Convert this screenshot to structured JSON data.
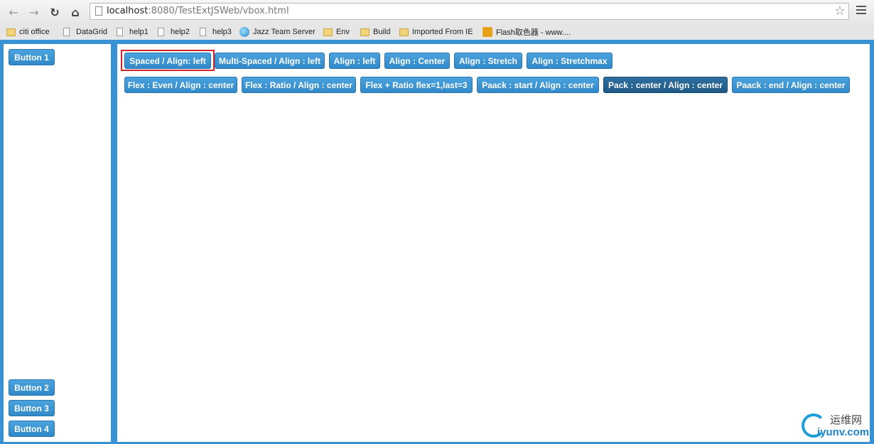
{
  "browser": {
    "url_host": "localhost",
    "url_rest": ":8080/TestExtJSWeb/vbox.html",
    "bookmarks": [
      {
        "label": "citi office",
        "icon": "folder-icon"
      },
      {
        "label": "DataGrid",
        "icon": "page-icon"
      },
      {
        "label": "help1",
        "icon": "page-icon"
      },
      {
        "label": "help2",
        "icon": "page-icon"
      },
      {
        "label": "help3",
        "icon": "page-icon"
      },
      {
        "label": "Jazz Team Server",
        "icon": "globe-icon"
      },
      {
        "label": "Env",
        "icon": "folder-icon"
      },
      {
        "label": "Build",
        "icon": "folder-icon"
      },
      {
        "label": "Imported From IE",
        "icon": "folder-icon"
      },
      {
        "label": "Flash取色器 - www....",
        "icon": "flash-icon"
      }
    ]
  },
  "west_panel": {
    "buttons": [
      "Button 1",
      "Button 2",
      "Button 3",
      "Button 4"
    ]
  },
  "center_panel": {
    "row1": [
      "Spaced / Align: left",
      "Multi-Spaced / Align : left",
      "Align : left",
      "Align : Center",
      "Align : Stretch",
      "Align : Stretchmax"
    ],
    "row2": [
      "Flex : Even / Align : center",
      "Flex : Ratio / Align : center",
      "Flex + Ratio flex=1,last=3",
      "Paack : start / Align : center",
      "Pack : center / Align : center",
      "Paack : end / Align : center"
    ],
    "selected": "Spaced / Align: left",
    "pressed": "Pack : center / Align : center"
  },
  "watermark": {
    "cn": "运维网",
    "en": "iyunv.com"
  },
  "colors": {
    "accent": "#3892d3",
    "button": "#3a90ce",
    "highlight": "#d1262b"
  }
}
